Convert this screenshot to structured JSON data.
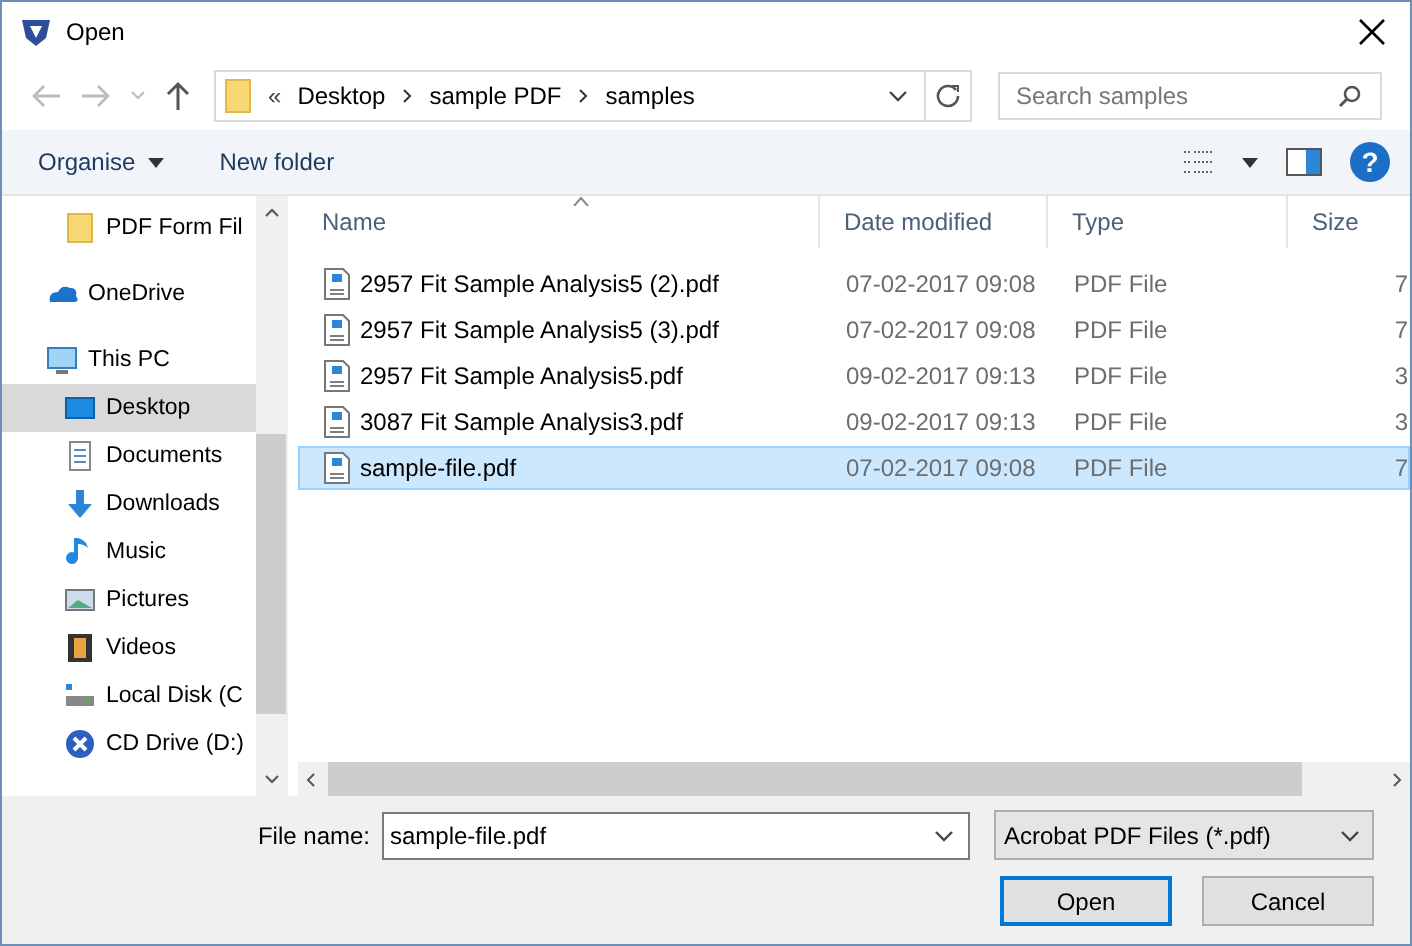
{
  "window": {
    "title": "Open"
  },
  "address": {
    "path": [
      "Desktop",
      "sample PDF",
      "samples"
    ],
    "overflow": "«"
  },
  "search": {
    "placeholder": "Search samples"
  },
  "toolbar": {
    "organise": "Organise",
    "new_folder": "New folder",
    "help": "?"
  },
  "sidebar": {
    "items": [
      {
        "label": "PDF Form Fil",
        "kind": "folder",
        "selected": false
      },
      {
        "label": "OneDrive",
        "kind": "cloud",
        "selected": false
      },
      {
        "label": "This PC",
        "kind": "monitor",
        "selected": false,
        "children": [
          {
            "label": "Desktop",
            "kind": "desktop",
            "selected": true
          },
          {
            "label": "Documents",
            "kind": "document",
            "selected": false
          },
          {
            "label": "Downloads",
            "kind": "download",
            "selected": false
          },
          {
            "label": "Music",
            "kind": "music",
            "selected": false
          },
          {
            "label": "Pictures",
            "kind": "picture",
            "selected": false
          },
          {
            "label": "Videos",
            "kind": "film",
            "selected": false
          },
          {
            "label": "Local Disk (C",
            "kind": "disk",
            "selected": false
          },
          {
            "label": "CD Drive (D:)",
            "kind": "cd",
            "selected": false
          }
        ]
      }
    ]
  },
  "table": {
    "columns": [
      "Name",
      "Date modified",
      "Type",
      "Size"
    ],
    "rows": [
      {
        "name": "2957 Fit Sample Analysis5 (2).pdf",
        "date": "07-02-2017 09:08",
        "type": "PDF File",
        "size": "7",
        "selected": false
      },
      {
        "name": "2957 Fit Sample Analysis5 (3).pdf",
        "date": "07-02-2017 09:08",
        "type": "PDF File",
        "size": "7",
        "selected": false
      },
      {
        "name": "2957 Fit Sample Analysis5.pdf",
        "date": "09-02-2017 09:13",
        "type": "PDF File",
        "size": "3",
        "selected": false
      },
      {
        "name": "3087 Fit Sample Analysis3.pdf",
        "date": "09-02-2017 09:13",
        "type": "PDF File",
        "size": "3",
        "selected": false
      },
      {
        "name": "sample-file.pdf",
        "date": "07-02-2017 09:08",
        "type": "PDF File",
        "size": "7",
        "selected": true
      }
    ]
  },
  "footer": {
    "file_name_label": "File name:",
    "file_name": "sample-file.pdf",
    "filter": "Acrobat PDF Files (*.pdf)",
    "buttons": [
      {
        "label": "Open",
        "default": true
      },
      {
        "label": "Cancel",
        "default": false
      }
    ]
  }
}
